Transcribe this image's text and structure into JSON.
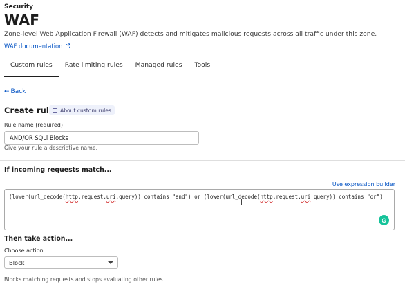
{
  "header": {
    "breadcrumb": "Security",
    "title": "WAF",
    "description": "Zone-level Web Application Firewall (WAF) detects and mitigates malicious requests across all traffic under this zone.",
    "doc_link": "WAF documentation",
    "doc_link_icon": "external-link-icon"
  },
  "tabs": [
    {
      "label": "Custom rules",
      "active": true
    },
    {
      "label": "Rate limiting rules",
      "active": false
    },
    {
      "label": "Managed rules",
      "active": false
    },
    {
      "label": "Tools",
      "active": false
    }
  ],
  "back_label": "Back",
  "create": {
    "title": "Create rule",
    "about_chip": "About custom rules",
    "about_icon": "document-icon"
  },
  "rule_name": {
    "label": "Rule name (required)",
    "value": "AND/OR SQLi Blocks",
    "hint": "Give your rule a descriptive name."
  },
  "match": {
    "heading": "If incoming requests match...",
    "expression_link": "Use expression builder",
    "expression": "(lower(url_decode(http.request.uri.query)) contains \"and\") or (lower(url_decode(http.request.uri.query)) contains \"or\")",
    "grammarly_icon": "G"
  },
  "action": {
    "heading": "Then take action...",
    "label": "Choose action",
    "selected": "Block",
    "note": "Blocks matching requests and stops evaluating other rules"
  },
  "colors": {
    "link": "#0051c3",
    "grammarly": "#15c39a"
  }
}
